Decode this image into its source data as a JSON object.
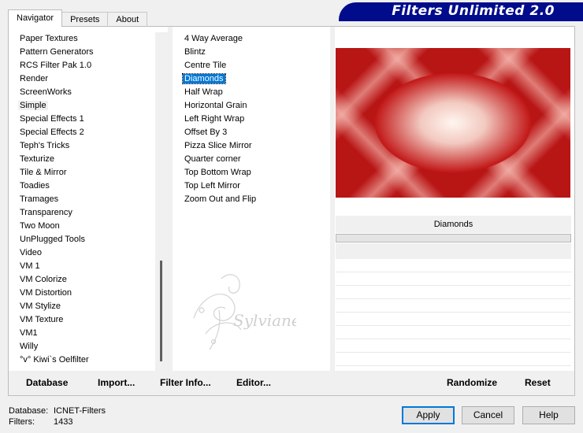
{
  "tabs": [
    {
      "label": "Navigator",
      "active": true
    },
    {
      "label": "Presets",
      "active": false
    },
    {
      "label": "About",
      "active": false
    }
  ],
  "banner": {
    "title": "Filters Unlimited 2.0"
  },
  "categories": {
    "items": [
      "Paper Textures",
      "Pattern Generators",
      "RCS Filter Pak 1.0",
      "Render",
      "ScreenWorks",
      "Simple",
      "Special Effects 1",
      "Special Effects 2",
      "Teph's Tricks",
      "Texturize",
      "Tile & Mirror",
      "Toadies",
      "Tramages",
      "Transparency",
      "Two Moon",
      "UnPlugged Tools",
      "Video",
      "VM 1",
      "VM Colorize",
      "VM Distortion",
      "VM Stylize",
      "VM Texture",
      "VM1",
      "Willy",
      "°v° Kiwi`s Oelfilter"
    ],
    "selected": "Simple"
  },
  "filters": {
    "items": [
      "4 Way Average",
      "Blintz",
      "Centre Tile",
      "Diamonds",
      "Half Wrap",
      "Horizontal Grain",
      "Left Right Wrap",
      "Offset By 3",
      "Pizza Slice Mirror",
      "Quarter corner",
      "Top Bottom Wrap",
      "Top Left Mirror",
      "Zoom Out and Flip"
    ],
    "selected": "Diamonds"
  },
  "preview": {
    "filter_name": "Diamonds",
    "colors": {
      "red": "#b81515",
      "light": "#fff6f0"
    }
  },
  "watermark": {
    "text": "Sylviane"
  },
  "toolbar": {
    "database": "Database",
    "import": "Import...",
    "filter_info": "Filter Info...",
    "editor": "Editor...",
    "randomize": "Randomize",
    "reset": "Reset"
  },
  "status": {
    "database_label": "Database:",
    "database_value": "ICNET-Filters",
    "filters_label": "Filters:",
    "filters_value": "1433"
  },
  "buttons": {
    "apply": "Apply",
    "cancel": "Cancel",
    "help": "Help"
  }
}
